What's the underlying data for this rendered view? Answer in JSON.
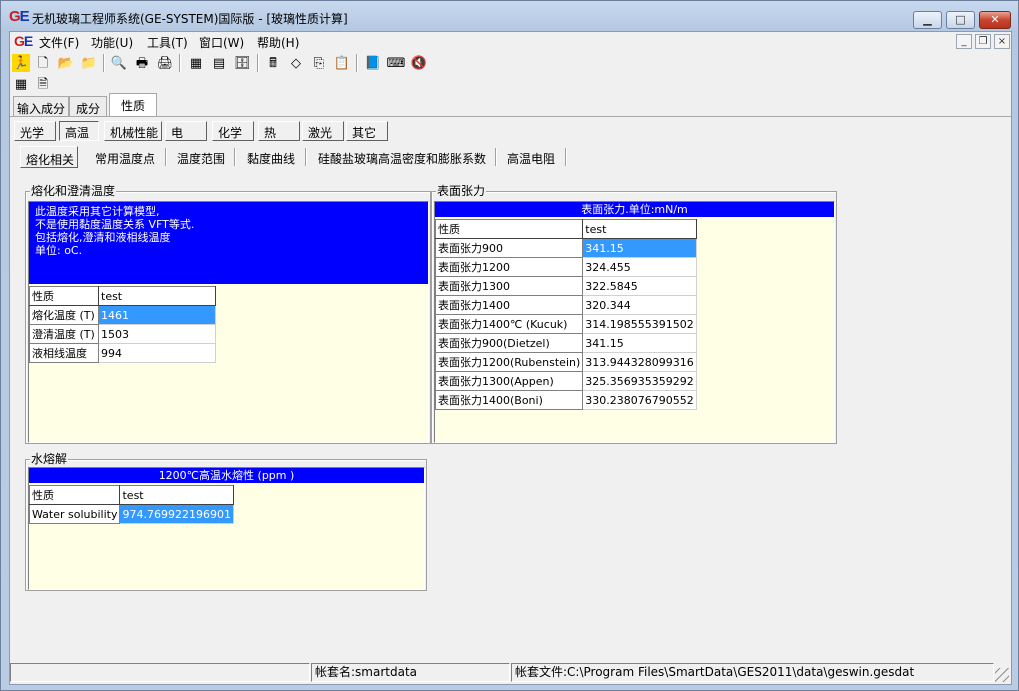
{
  "window": {
    "title": "无机玻璃工程师系统(GE-SYSTEM)国际版 - [玻璃性质计算]",
    "logo_g": "G",
    "logo_e": "E",
    "minimize_symbol": "▁",
    "maximize_symbol": "□",
    "close_symbol": "✕"
  },
  "menubar": {
    "items": [
      "文件(F)",
      "功能(U)",
      "工具(T)",
      "窗口(W)",
      "帮助(H)"
    ],
    "mdi_minimize": "_",
    "mdi_restore": "❐",
    "mdi_close": "×"
  },
  "toolbar": {
    "icons": [
      "run-icon",
      "new-file-icon",
      "open-folder-icon",
      "folder-icon",
      "print-preview-icon",
      "print-setup-icon",
      "print-icon",
      "table-icon",
      "grid-icon",
      "database-icon",
      "calculator-icon",
      "eraser-icon",
      "copy-icon",
      "paste-icon",
      "book-icon",
      "keyboard-icon",
      "speaker-icon",
      "spreadsheet-icon",
      "report-icon"
    ]
  },
  "tabs": [
    "输入成分",
    "成分",
    "性质"
  ],
  "categories": [
    "光学",
    "高温",
    "机械性能",
    "电",
    "化学",
    "热",
    "激光",
    "其它"
  ],
  "subtabs": [
    "熔化相关",
    "常用温度点",
    "温度范围",
    "黏度曲线",
    "硅酸盐玻璃高温密度和膨胀系数",
    "高温电阻"
  ],
  "melting": {
    "group_title": "熔化和澄清温度",
    "notes": [
      "此温度采用其它计算模型,",
      "不是使用黏度温度关系 VFT等式.",
      "包括熔化,澄清和液相线温度",
      "单位: oC."
    ],
    "col_property": "性质",
    "col_test": "test",
    "rows": [
      {
        "label": "熔化温度 (T)",
        "value": "1461"
      },
      {
        "label": "澄清温度 (T)",
        "value": "1503"
      },
      {
        "label": "液相线温度",
        "value": "994"
      }
    ]
  },
  "surface_tension": {
    "group_title": "表面张力",
    "header": "表面张力.单位:mN/m",
    "col_property": "性质",
    "col_test": "test",
    "rows": [
      {
        "label": "表面张力900",
        "value": "341.15"
      },
      {
        "label": "表面张力1200",
        "value": "324.455"
      },
      {
        "label": "表面张力1300",
        "value": "322.5845"
      },
      {
        "label": "表面张力1400",
        "value": "320.344"
      },
      {
        "label": "表面张力1400℃ (Kucuk)",
        "value": "314.198555391502"
      },
      {
        "label": "表面张力900(Dietzel)",
        "value": "341.15"
      },
      {
        "label": "表面张力1200(Rubenstein)",
        "value": "313.944328099316"
      },
      {
        "label": "表面张力1300(Appen)",
        "value": "325.356935359292"
      },
      {
        "label": "表面张力1400(Boni)",
        "value": "330.238076790552"
      }
    ]
  },
  "water": {
    "group_title": "水熔解",
    "header": "1200℃高温水熔性 (ppm )",
    "col_property": "性质",
    "col_test": "test",
    "rows": [
      {
        "label": "Water solubility",
        "value": "974.769922196901"
      }
    ]
  },
  "statusbar": {
    "account": "帐套名:smartdata",
    "file": "帐套文件:C:\\Program Files\\SmartData\\GES2011\\data\\geswin.gesdat"
  }
}
